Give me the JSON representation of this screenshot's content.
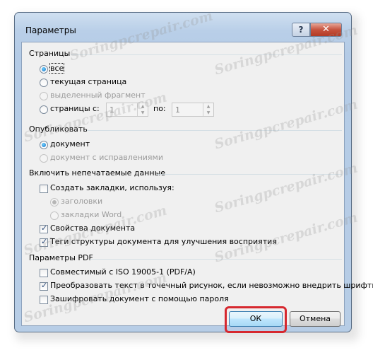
{
  "window": {
    "title": "Параметры",
    "help_label": "?",
    "close_label": "✕"
  },
  "pages": {
    "heading": "Страницы",
    "all": "все",
    "current": "текущая страница",
    "selection": "выделенный фрагмент",
    "range": "страницы",
    "from_label": "с:",
    "from_value": "1",
    "to_label": "по:",
    "to_value": "1"
  },
  "publish": {
    "heading": "Опубликовать",
    "document": "документ",
    "with_markup": "документ с исправлениями"
  },
  "nonprint": {
    "heading": "Включить непечатаемые данные",
    "bookmarks": "Создать закладки, используя:",
    "headings": "заголовки",
    "word_bookmarks": "закладки Word",
    "properties": "Свойства документа",
    "structure_tags": "Теги структуры документа для улучшения восприятия"
  },
  "pdf": {
    "heading": "Параметры PDF",
    "iso": "Совместимый с ISO 19005-1 (PDF/A)",
    "bitmap": "Преобразовать текст в точечный рисунок, если невозможно внедрить шрифты",
    "encrypt": "Зашифровать документ с помощью пароля"
  },
  "buttons": {
    "ok": "ОК",
    "cancel": "Отмена"
  },
  "watermark": "Soringpcrepair.com",
  "colors": {
    "highlight": "#d6282f",
    "accent": "#1b6fc2"
  }
}
